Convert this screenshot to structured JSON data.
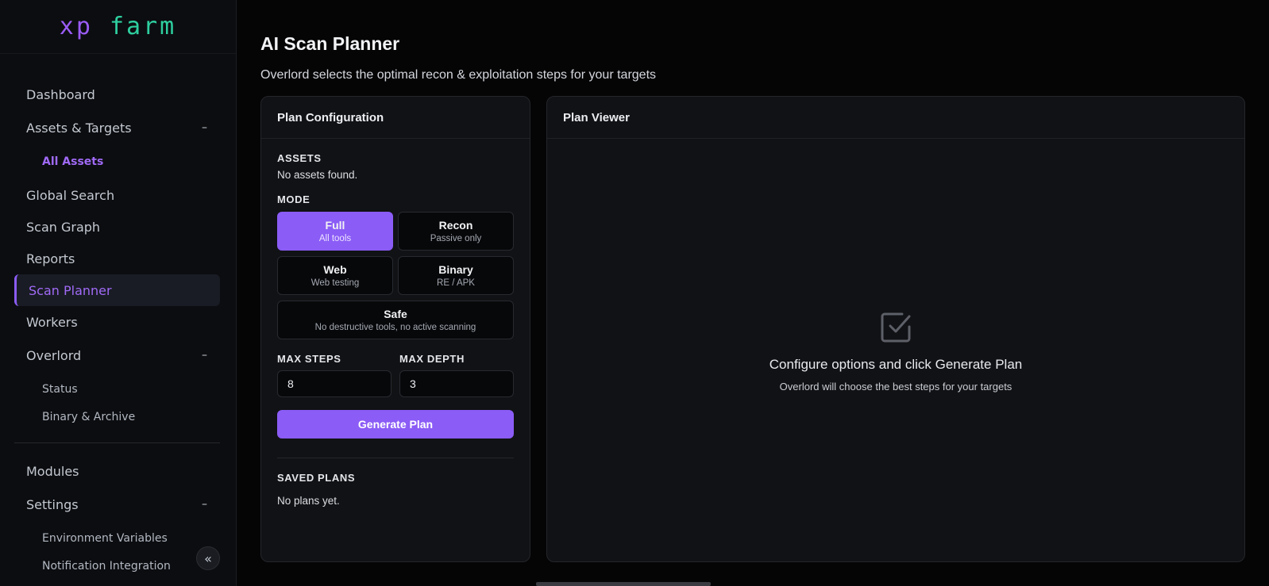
{
  "brand": {
    "logo_xp": "xp",
    "logo_farm": "farm"
  },
  "sidebar": {
    "items": [
      {
        "label": "Dashboard"
      },
      {
        "label": "Assets & Targets",
        "toggle": "–"
      },
      {
        "label": "Global Search"
      },
      {
        "label": "Scan Graph"
      },
      {
        "label": "Reports"
      },
      {
        "label": "Scan Planner"
      },
      {
        "label": "Workers"
      },
      {
        "label": "Overlord",
        "toggle": "–"
      },
      {
        "label": "Modules"
      },
      {
        "label": "Settings",
        "toggle": "–"
      }
    ],
    "subitems": {
      "all_assets": "All Assets",
      "status": "Status",
      "binary_archive": "Binary & Archive",
      "env_vars": "Environment Variables",
      "notification": "Notification Integration"
    },
    "collapse_glyph": "«"
  },
  "page": {
    "title": "AI Scan Planner",
    "subtitle": "Overlord selects the optimal recon & exploitation steps for your targets"
  },
  "config": {
    "header": "Plan Configuration",
    "assets_label": "ASSETS",
    "assets_empty": "No assets found.",
    "mode_label": "MODE",
    "modes": [
      {
        "title": "Full",
        "sub": "All tools"
      },
      {
        "title": "Recon",
        "sub": "Passive only"
      },
      {
        "title": "Web",
        "sub": "Web testing"
      },
      {
        "title": "Binary",
        "sub": "RE / APK"
      },
      {
        "title": "Safe",
        "sub": "No destructive tools, no active scanning"
      }
    ],
    "selected_mode": "Full",
    "max_steps_label": "MAX STEPS",
    "max_steps_value": "8",
    "max_depth_label": "MAX DEPTH",
    "max_depth_value": "3",
    "generate_label": "Generate Plan",
    "saved_label": "SAVED PLANS",
    "saved_empty": "No plans yet."
  },
  "viewer": {
    "header": "Plan Viewer",
    "empty_icon": "checkbox-icon",
    "empty_title": "Configure options and click Generate Plan",
    "empty_sub": "Overlord will choose the best steps for your targets"
  },
  "colors": {
    "accent": "#8b5cf6",
    "logo_xp": "#9a5cf5",
    "logo_farm": "#2ecfa0"
  }
}
